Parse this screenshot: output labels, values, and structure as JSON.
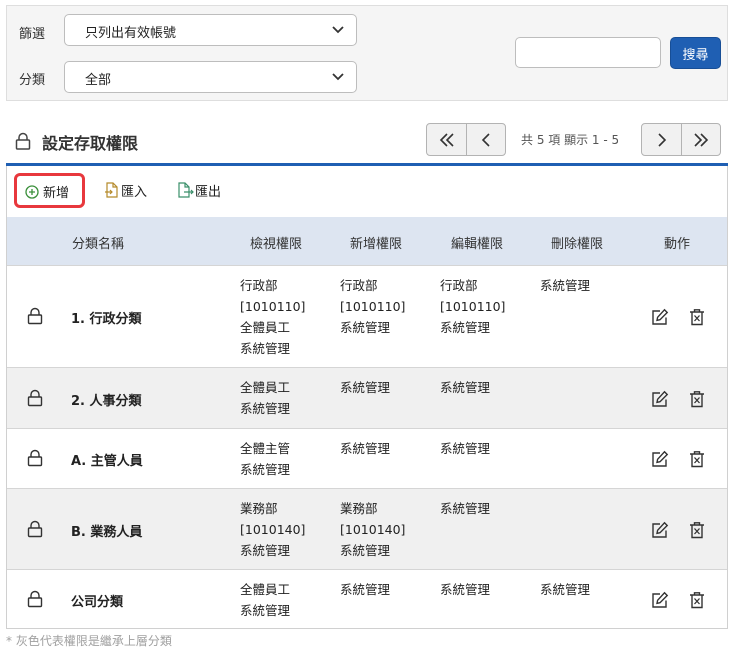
{
  "filter": {
    "filter_label": "篩選",
    "filter_value": "只列出有效帳號",
    "category_label": "分類",
    "category_value": "全部",
    "search_value": "",
    "search_button": "搜尋"
  },
  "section": {
    "title": "設定存取權限",
    "pager_info": "共 5 項 顯示 1 - 5"
  },
  "toolbar": {
    "add_label": "新增",
    "import_label": "匯入",
    "export_label": "匯出"
  },
  "table": {
    "headers": {
      "name": "分類名稱",
      "view": "檢視權限",
      "add": "新增權限",
      "edit": "編輯權限",
      "delete": "刪除權限",
      "action": "動作"
    },
    "rows": [
      {
        "name": "1. 行政分類",
        "view": [
          "行政部",
          "[1010110]",
          "全體員工",
          "系統管理"
        ],
        "add": [
          "行政部",
          "[1010110]",
          "系統管理"
        ],
        "edit": [
          "行政部",
          "[1010110]",
          "系統管理"
        ],
        "delete": [
          "系統管理"
        ]
      },
      {
        "name": "2. 人事分類",
        "view": [
          "全體員工",
          "系統管理"
        ],
        "add": [
          "系統管理"
        ],
        "edit": [
          "系統管理"
        ],
        "delete": []
      },
      {
        "name": "A. 主管人員",
        "view": [
          "全體主管",
          "系統管理"
        ],
        "add": [
          "系統管理"
        ],
        "edit": [
          "系統管理"
        ],
        "delete": []
      },
      {
        "name": "B. 業務人員",
        "view": [
          "業務部",
          "[1010140]",
          "系統管理"
        ],
        "add": [
          "業務部",
          "[1010140]",
          "系統管理"
        ],
        "edit": [
          "系統管理"
        ],
        "delete": []
      },
      {
        "name": "公司分類",
        "view": [
          "全體員工",
          "系統管理"
        ],
        "add": [
          "系統管理"
        ],
        "edit": [
          "系統管理"
        ],
        "delete": [
          "系統管理"
        ]
      }
    ]
  },
  "footnote": "* 灰色代表權限是繼承上層分類",
  "icons": {
    "category_lock": "lock-icon",
    "add": "plus-circle-icon",
    "import": "file-import-icon",
    "export": "file-export-icon",
    "edit": "edit-icon",
    "delete": "trash-icon"
  },
  "colors": {
    "accent": "#1f5fb3",
    "highlight": "#e8383d",
    "header_bg": "#dde5f1",
    "alt_row_bg": "#f0f0f0"
  }
}
